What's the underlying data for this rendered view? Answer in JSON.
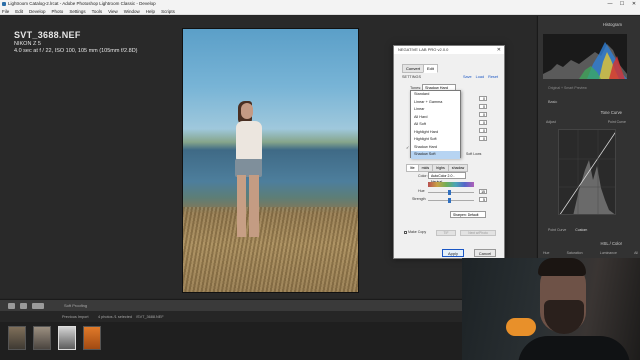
{
  "window": {
    "title": "Lightroom Catalog-2.lrcat - Adobe Photoshop Lightroom Classic - Develop",
    "controls": [
      "—",
      "☐",
      "✕"
    ]
  },
  "menu": [
    "File",
    "Edit",
    "Develop",
    "Photo",
    "Settings",
    "Tools",
    "View",
    "Window",
    "Help",
    "Scripts"
  ],
  "photo_info": {
    "filename": "SVT_3688.NEF",
    "camera": "NIKON Z 5",
    "exposure": "4.0 sec at f / 22, ISO 100, 105 mm (105mm f/2.8D)"
  },
  "nlp": {
    "title": "NEGATIVE LAB PRO v2.0.0",
    "close": "✕",
    "tabs": [
      "Convert",
      "Edit"
    ],
    "active_tab": "Edit",
    "settings_label": "SETTINGS",
    "links": [
      "Save",
      "Load",
      "Reset"
    ],
    "tones_label": "Tones:",
    "tones_value": "Shadow Hard",
    "tone_options": [
      "Standard",
      "Linear + Gamma",
      "Linear",
      "All Hard",
      "All Soft",
      "Highlight Hard",
      "Highlight Soft",
      "Shadow Hard",
      "Shadow Soft"
    ],
    "checked_option": "Shadow Hard",
    "highlighted_option": "Shadow Soft",
    "num_values": [
      "0",
      "0",
      "0",
      "0",
      "0",
      "0"
    ],
    "soft_lows": "Soft Lows",
    "subtabs": [
      "lite",
      "mids",
      "highs",
      "shadow"
    ],
    "color_label": "Color:",
    "color_value": "AutoColor 2.0 - Neutral",
    "hue_label": "Hue",
    "hue_value": "15",
    "strength_label": "Strength",
    "strength_value": "5",
    "sharpen_value": "Sharpen: Default",
    "make_copy": "Make Copy",
    "tif_label": "TIF",
    "next_label": "Next w/Photo",
    "apply": "Apply",
    "cancel": "Cancel"
  },
  "right_panel": {
    "histogram_title": "Histogram",
    "histogram_info": "Original + Smart Preview",
    "basic": "Basic",
    "tone_curve_title": "Tone Curve",
    "tc_labels": [
      "Adjust",
      "Point Curve"
    ],
    "point_curve_label": "Point Curve",
    "point_curve_value": "Custom",
    "hsl_title": "HSL / Color",
    "hsl_tabs": [
      "Hue",
      "Saturation",
      "Luminance",
      "All"
    ]
  },
  "toolbar": {
    "soft_proofing": "Soft Proofing"
  },
  "filmstrip": {
    "source": "Previous Import",
    "count": "4 photos /1 selected",
    "path": "/SVT_3688.NEF"
  },
  "colors": {
    "accent": "#1a56c4",
    "highlight": "#b7d4f2",
    "mic": "#e8902a"
  }
}
